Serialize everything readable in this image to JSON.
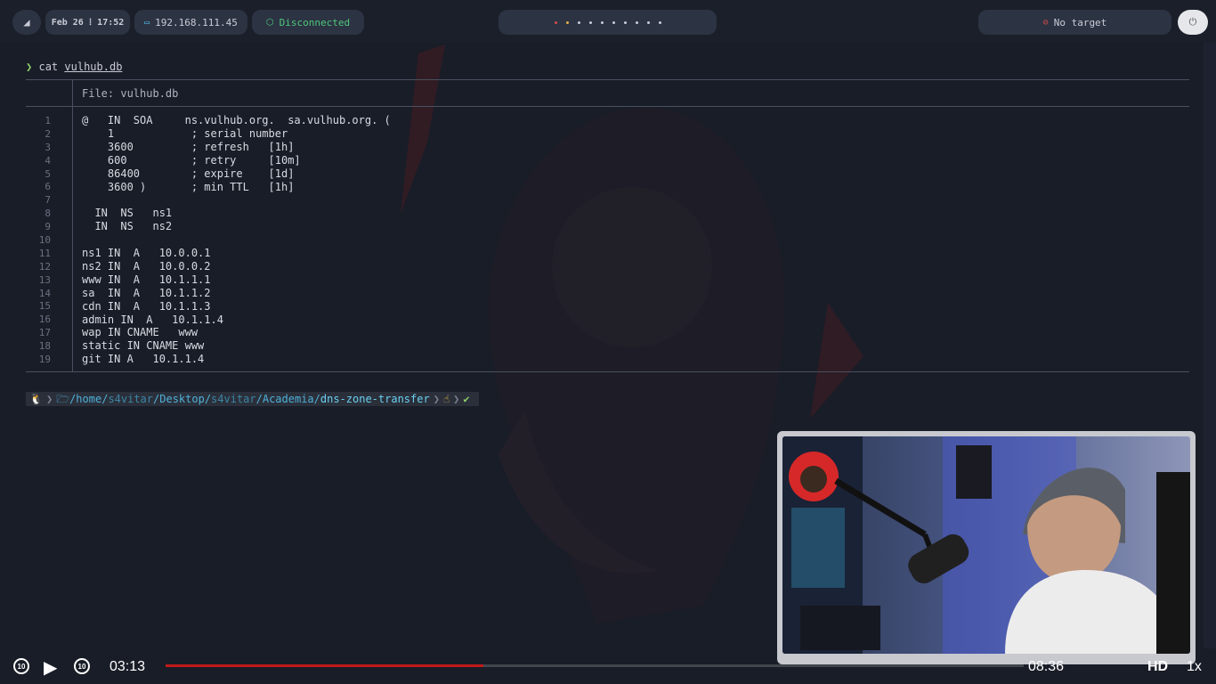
{
  "topbar": {
    "menu_icon": "arch-logo-icon",
    "datetime": "Feb 26 ⁞ 17:52",
    "ip": "192.168.111.45",
    "vpn_status": "Disconnected",
    "target": "No target"
  },
  "terminal": {
    "command": "cat",
    "command_file": "vulhub.db",
    "file_header": "File: vulhub.db",
    "lines": [
      {
        "n": "1",
        "t": "@   IN  SOA     ns.vulhub.org.  sa.vulhub.org. ("
      },
      {
        "n": "2",
        "t": "    1            ; serial number"
      },
      {
        "n": "3",
        "t": "    3600         ; refresh   [1h]"
      },
      {
        "n": "4",
        "t": "    600          ; retry     [10m]"
      },
      {
        "n": "5",
        "t": "    86400        ; expire    [1d]"
      },
      {
        "n": "6",
        "t": "    3600 )       ; min TTL   [1h]"
      },
      {
        "n": "7",
        "t": ""
      },
      {
        "n": "8",
        "t": "  IN  NS   ns1"
      },
      {
        "n": "9",
        "t": "  IN  NS   ns2"
      },
      {
        "n": "10",
        "t": ""
      },
      {
        "n": "11",
        "t": "ns1 IN  A   10.0.0.1"
      },
      {
        "n": "12",
        "t": "ns2 IN  A   10.0.0.2"
      },
      {
        "n": "13",
        "t": "www IN  A   10.1.1.1"
      },
      {
        "n": "14",
        "t": "sa  IN  A   10.1.1.2"
      },
      {
        "n": "15",
        "t": "cdn IN  A   10.1.1.3"
      },
      {
        "n": "16",
        "t": "admin IN  A   10.1.1.4"
      },
      {
        "n": "17",
        "t": "wap IN CNAME   www"
      },
      {
        "n": "18",
        "t": "static IN CNAME www"
      },
      {
        "n": "19",
        "t": "git IN A   10.1.1.4"
      }
    ],
    "prompt": {
      "os_icon": "linux-tux-icon",
      "path_prefix": "/home/",
      "path_user": "s4vitar",
      "path_mid1": "/Desktop/",
      "path_mid2": "s4vitar",
      "path_mid3": "/Academia/",
      "path_dir": "dns-zone-transfer",
      "status_icon": "hand-icon",
      "ok_glyph": "✔"
    }
  },
  "player": {
    "current_time": "03:13",
    "total_time": "08:36",
    "progress": 0.37,
    "quality": "HD",
    "speed": "1x",
    "skip_back_label": "10",
    "skip_fwd_label": "10"
  }
}
